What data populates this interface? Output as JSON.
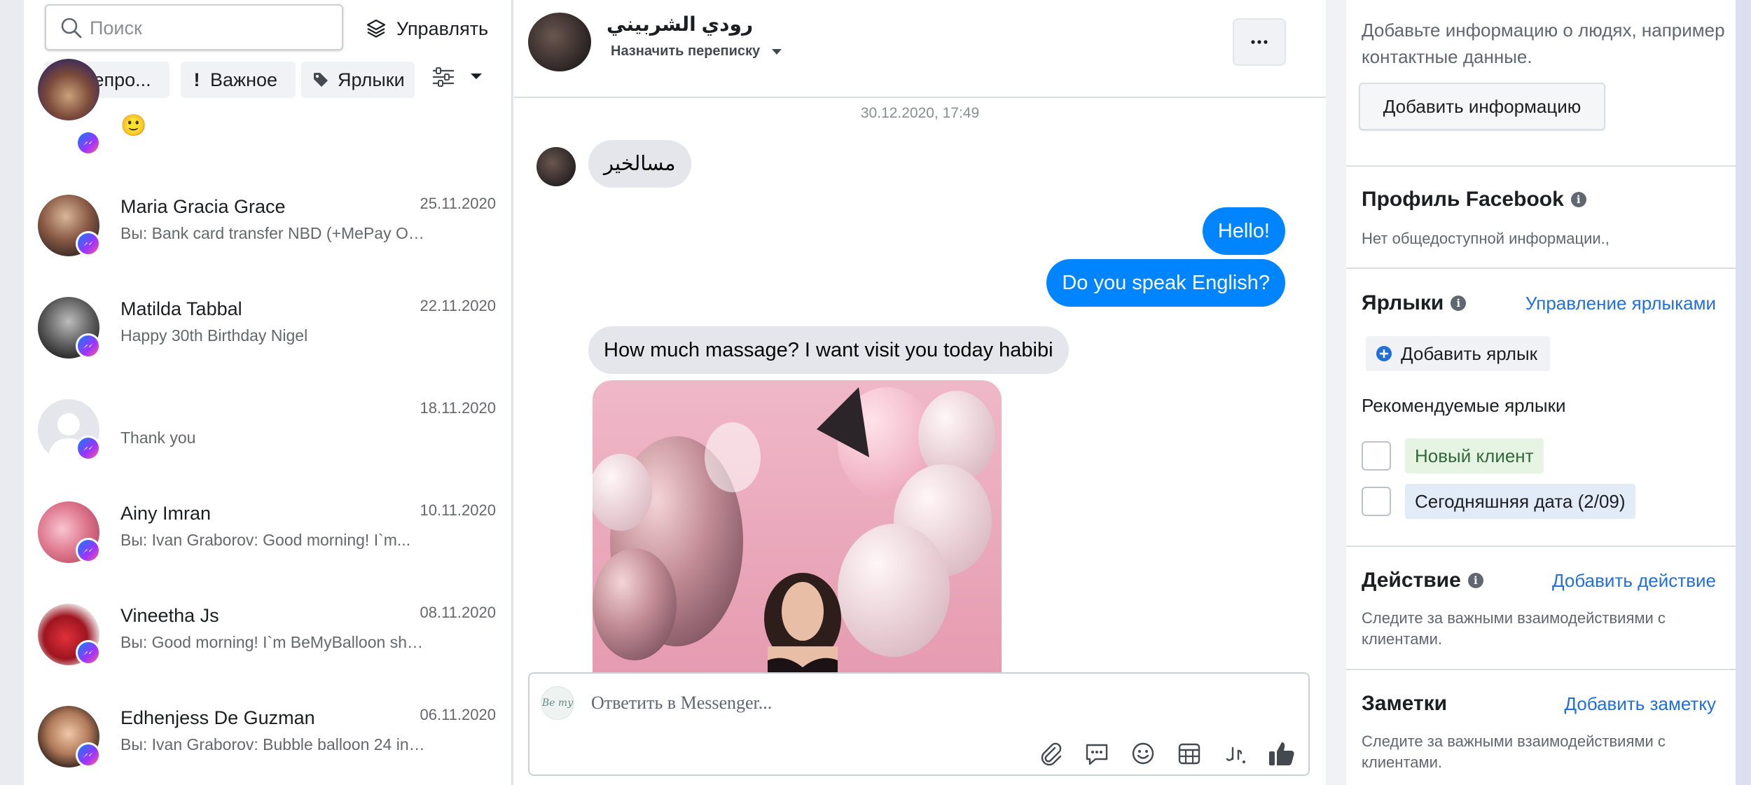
{
  "left_panel": {
    "search": {
      "placeholder": "Поиск"
    },
    "manage_label": "Управлять",
    "filters": {
      "unread": "Непро...",
      "important": "Важное",
      "labels": "Ярлыки"
    },
    "first_item": {
      "emoji": "🙂"
    },
    "conversations": [
      {
        "name": "Maria Gracia Grace",
        "date": "25.11.2020",
        "preview": "Вы: Bank card transfer NBD (+MePay Optio..."
      },
      {
        "name": "Matilda Tabbal",
        "date": "22.11.2020",
        "preview": "Happy 30th Birthday Nigel"
      },
      {
        "name": "",
        "date": "18.11.2020",
        "preview": "Thank you"
      },
      {
        "name": "Ainy Imran",
        "date": "10.11.2020",
        "preview": "Вы: Ivan Graborov: Good morning! I`m..."
      },
      {
        "name": "Vineetha Js",
        "date": "08.11.2020",
        "preview": "Вы: Good morning! I`m BeMyBalloon shop..."
      },
      {
        "name": "Edhenjess De Guzman",
        "date": "06.11.2020",
        "preview": "Вы: Ivan Graborov: Bubble balloon 24 inch..."
      }
    ]
  },
  "chat": {
    "contact_name": "رودي الشربيني",
    "assign_label": "Назначить переписку",
    "timestamp": "30.12.2020, 17:49",
    "messages": [
      {
        "from": "them",
        "text": "مسالخير"
      },
      {
        "from": "me",
        "text": "Hello!"
      },
      {
        "from": "me",
        "text": "Do you speak English?"
      },
      {
        "from": "them",
        "text": "How much massage? I want visit you today habibi"
      }
    ],
    "composer": {
      "placeholder": "Ответить в Messenger...",
      "page_avatar_text": "Be my"
    }
  },
  "right_panel": {
    "info_text": "Добавьте информацию о людях, например контактные данные.",
    "add_info_button": "Добавить информацию",
    "facebook_profile": {
      "title": "Профиль Facebook",
      "text": "Нет общедоступной информации.,"
    },
    "labels": {
      "title": "Ярлыки",
      "manage_link": "Управление ярлыками",
      "add_button": "Добавить ярлык",
      "recommended_title": "Рекомендуемые ярлыки",
      "items": [
        {
          "text": "Новый клиент",
          "bg": "#e6f4e4",
          "fg": "#31693a"
        },
        {
          "text": "Сегодняшняя дата (2/09)",
          "bg": "#e2ebf8",
          "fg": "#1c1e21"
        }
      ]
    },
    "action": {
      "title": "Действие",
      "link": "Добавить действие",
      "text": "Следите за важными взаимодействиями с клиентами."
    },
    "notes": {
      "title": "Заметки",
      "link": "Добавить заметку",
      "text": "Следите за важными взаимодействиями с клиентами."
    }
  },
  "colors": {
    "accent": "#0084ff",
    "link": "#216fdb",
    "icon": "#444950"
  }
}
